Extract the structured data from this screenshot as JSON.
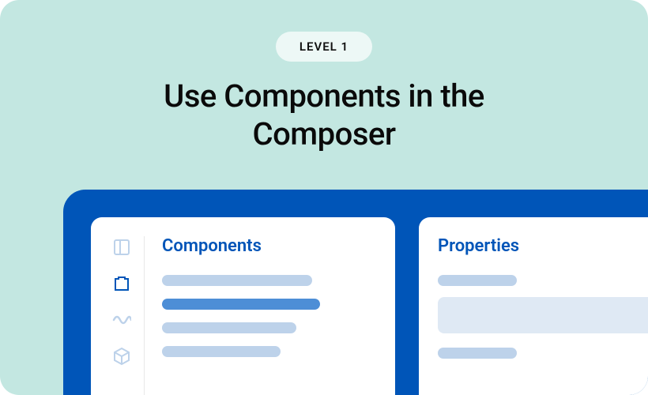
{
  "badge": "LEVEL 1",
  "title_line1": "Use Components in the",
  "title_line2": "Composer",
  "panels": {
    "left_title": "Components",
    "right_title": "Properties"
  },
  "rail_icons": [
    "panel-icon",
    "block-icon",
    "wave-icon",
    "cube-icon"
  ],
  "colors": {
    "card_bg": "#c3e7e1",
    "accent": "#0055b8",
    "skeleton_light": "#bdd2ea",
    "skeleton_dark": "#4d8ed6",
    "skeleton_block": "#dfe9f4"
  }
}
